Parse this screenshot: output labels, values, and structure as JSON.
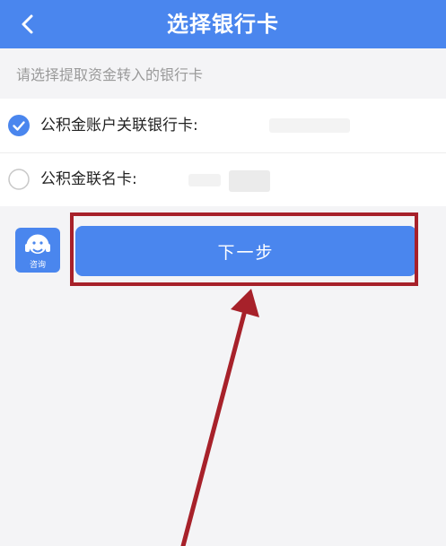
{
  "header": {
    "title": "选择银行卡",
    "back_icon": "chevron-left-icon",
    "background": "#4a86ee"
  },
  "hint": "请选择提取资金转入的银行卡",
  "options": [
    {
      "label": "公积金账户关联银行卡:",
      "selected": true
    },
    {
      "label": "公积金联名卡:",
      "selected": false
    }
  ],
  "consult": {
    "label": "咨询",
    "icon": "customer-service-icon"
  },
  "next_button": {
    "label": "下一步"
  },
  "annotation": {
    "color": "#a7212a"
  }
}
